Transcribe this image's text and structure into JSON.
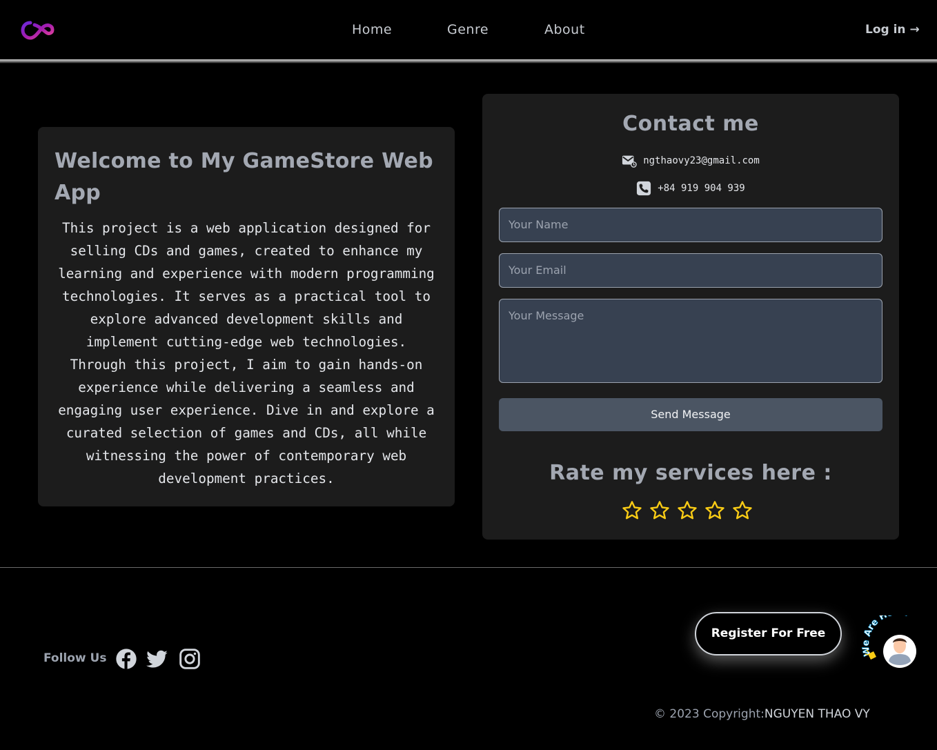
{
  "header": {
    "nav": {
      "home": "Home",
      "genre": "Genre",
      "about": "About"
    },
    "login": "Log in →"
  },
  "welcome": {
    "title": "Welcome to My GameStore Web App",
    "body": "This project is a web application designed for selling CDs and games, created to enhance my learning and experience with modern programming technologies. It serves as a practical tool to explore advanced development skills and implement cutting-edge web technologies. Through this project, I aim to gain hands-on experience while delivering a seamless and engaging user experience. Dive in and explore a curated selection of games and CDs, all while witnessing the power of contemporary web development practices."
  },
  "contact": {
    "title": "Contact me",
    "email": "ngthaovy23@gmail.com",
    "phone": "+84 919 904 939",
    "name_placeholder": "Your Name",
    "email_placeholder": "Your Email",
    "message_placeholder": "Your Message",
    "send_label": "Send Message",
    "rate_title": "Rate my services here :",
    "rating": {
      "value": 0,
      "max": 5
    }
  },
  "footer": {
    "follow": "Follow Us",
    "social": [
      "facebook-icon",
      "twitter-icon",
      "instagram-icon"
    ],
    "register_label": "Register For Free",
    "badge_text": "We Are Here!",
    "copyright_prefix": "© 2023 Copyright:",
    "copyright_name": "NGUYEN THAO VY"
  },
  "colors": {
    "background": "#000000",
    "card": "#1c1c1c",
    "input": "#374151",
    "button": "#4b5563",
    "star": "#facc15",
    "logo_gradient": [
      "#7c3aed",
      "#ec4899"
    ]
  }
}
